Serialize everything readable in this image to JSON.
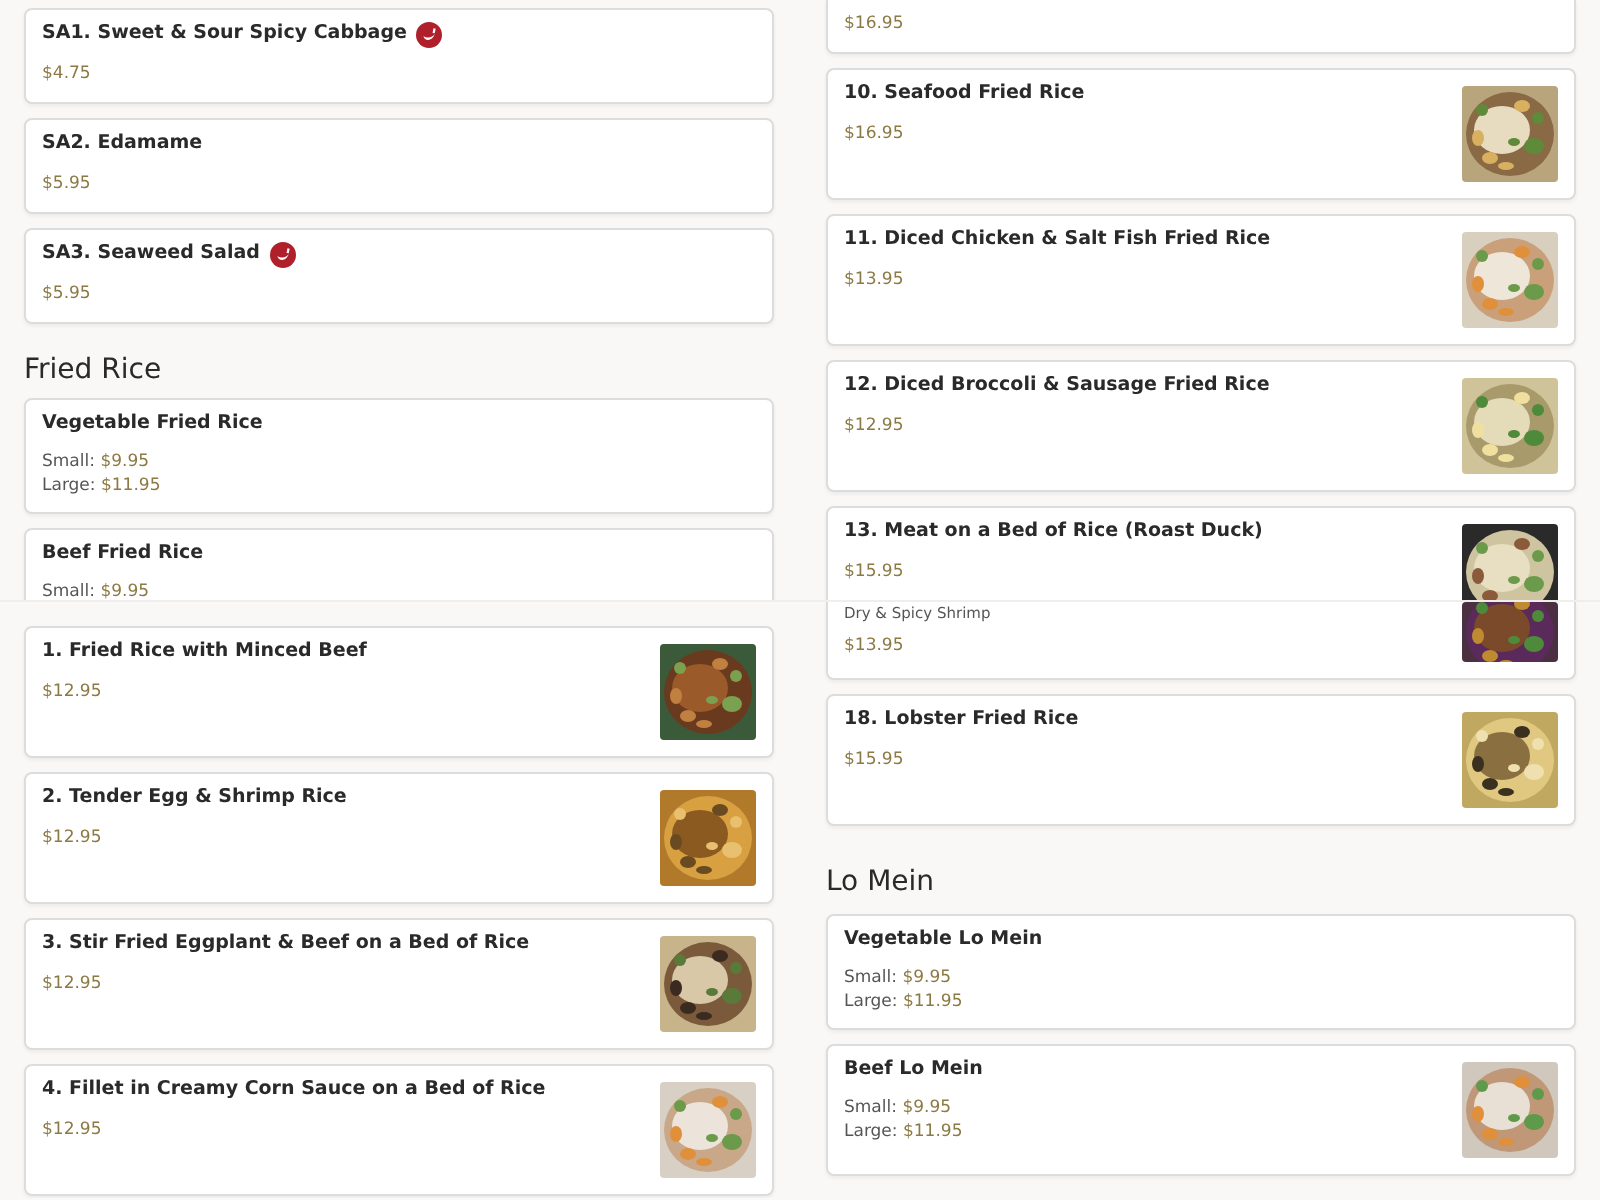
{
  "panels": [
    {
      "columns": [
        {
          "blocks": [
            {
              "kind": "card",
              "title": "SA1. Sweet & Sour Spicy Cabbage",
              "spicy": true,
              "prices": [
                {
                  "amount": "$4.75"
                }
              ]
            },
            {
              "kind": "card",
              "title": "SA2. Edamame",
              "spicy": false,
              "prices": [
                {
                  "amount": "$5.95"
                }
              ]
            },
            {
              "kind": "card",
              "title": "SA3. Seaweed Salad",
              "spicy": true,
              "prices": [
                {
                  "amount": "$5.95"
                }
              ]
            },
            {
              "kind": "heading",
              "title": "Fried Rice"
            },
            {
              "kind": "card",
              "title": "Vegetable Fried Rice",
              "spicy": false,
              "prices": [
                {
                  "label": "Small:",
                  "amount": "$9.95"
                },
                {
                  "label": "Large:",
                  "amount": "$11.95"
                }
              ]
            },
            {
              "kind": "card",
              "title": "Beef Fried Rice",
              "spicy": false,
              "prices": [
                {
                  "label": "Small:",
                  "amount": "$9.95"
                }
              ]
            }
          ]
        },
        {
          "blocks": [
            {
              "kind": "card",
              "continued": true,
              "prices": [
                {
                  "amount": "$16.95"
                }
              ]
            },
            {
              "kind": "card",
              "title": "10. Seafood Fried Rice",
              "spicy": false,
              "prices": [
                {
                  "amount": "$16.95"
                }
              ],
              "picture": {
                "kind": "picture"
              }
            },
            {
              "kind": "card",
              "title": "11. Diced Chicken & Salt Fish Fried Rice",
              "spicy": false,
              "prices": [
                {
                  "amount": "$13.95"
                }
              ],
              "picture": {
                "kind": "picture"
              }
            },
            {
              "kind": "card",
              "title": "12. Diced Broccoli & Sausage Fried Rice",
              "spicy": false,
              "prices": [
                {
                  "amount": "$12.95"
                }
              ],
              "picture": {
                "kind": "picture"
              }
            },
            {
              "kind": "card",
              "title": "13. Meat on a Bed of Rice (Roast Duck)",
              "spicy": false,
              "prices": [
                {
                  "amount": "$15.95"
                }
              ],
              "picture": {
                "kind": "picture"
              }
            }
          ]
        }
      ]
    },
    {
      "columns": [
        {
          "blocks": [
            {
              "kind": "card",
              "title": "1. Fried Rice with Minced Beef",
              "spicy": false,
              "prices": [
                {
                  "amount": "$12.95"
                }
              ],
              "picture": {
                "kind": "picture"
              }
            },
            {
              "kind": "card",
              "title": "2. Tender Egg & Shrimp Rice",
              "spicy": false,
              "prices": [
                {
                  "amount": "$12.95"
                }
              ],
              "picture": {
                "kind": "picture"
              }
            },
            {
              "kind": "card",
              "title": "3. Stir Fried Eggplant & Beef on a Bed of Rice",
              "spicy": false,
              "prices": [
                {
                  "amount": "$12.95"
                }
              ],
              "picture": {
                "kind": "picture"
              }
            },
            {
              "kind": "card",
              "title": "4. Fillet in Creamy Corn Sauce on a Bed of Rice",
              "spicy": false,
              "prices": [
                {
                  "amount": "$12.95"
                }
              ],
              "picture": {
                "kind": "picture"
              }
            }
          ]
        },
        {
          "blocks": [
            {
              "kind": "card",
              "continued": true,
              "description": "Dry & Spicy Shrimp",
              "prices": [
                {
                  "amount": "$13.95"
                }
              ],
              "picture": {
                "kind": "picture"
              }
            },
            {
              "kind": "card",
              "title": "18. Lobster Fried Rice",
              "spicy": false,
              "prices": [
                {
                  "amount": "$15.95"
                }
              ],
              "picture": {
                "kind": "picture"
              }
            },
            {
              "kind": "heading",
              "title": "Lo Mein"
            },
            {
              "kind": "card",
              "title": "Vegetable Lo Mein",
              "spicy": false,
              "prices": [
                {
                  "label": "Small:",
                  "amount": "$9.95"
                },
                {
                  "label": "Large:",
                  "amount": "$11.95"
                }
              ]
            },
            {
              "kind": "card",
              "title": "Beef Lo Mein",
              "spicy": false,
              "prices": [
                {
                  "label": "Small:",
                  "amount": "$9.95"
                },
                {
                  "label": "Large:",
                  "amount": "$11.95"
                }
              ],
              "picture": {
                "kind": "picture"
              }
            }
          ]
        }
      ]
    }
  ]
}
